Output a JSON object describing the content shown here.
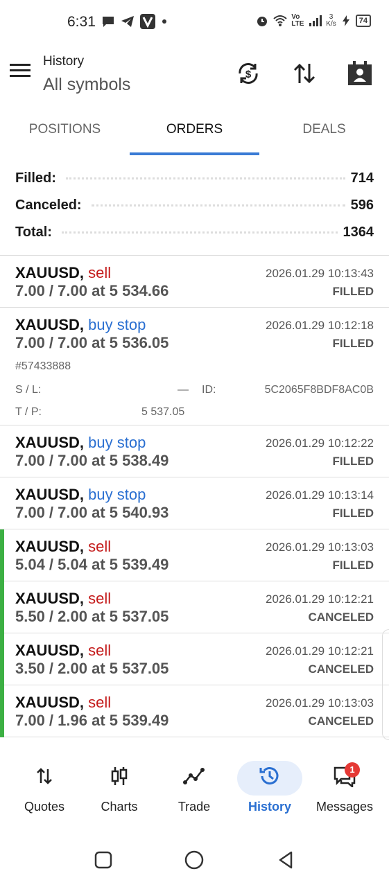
{
  "status_bar": {
    "time": "6:31",
    "network_label": "Vo LTE",
    "speed_value": "3",
    "speed_unit": "K/s",
    "battery": "74"
  },
  "header": {
    "title": "History",
    "subtitle": "All symbols"
  },
  "tabs": [
    {
      "label": "POSITIONS",
      "active": false
    },
    {
      "label": "ORDERS",
      "active": true
    },
    {
      "label": "DEALS",
      "active": false
    }
  ],
  "summary": [
    {
      "label": "Filled:",
      "value": "714"
    },
    {
      "label": "Canceled:",
      "value": "596"
    },
    {
      "label": "Total:",
      "value": "1364"
    }
  ],
  "orders": [
    {
      "symbol": "XAUUSD,",
      "type": "sell",
      "volume": "7.00 / 7.00 at 5 534.66",
      "time": "2026.01.29 10:13:43",
      "status": "FILLED",
      "marked": false
    },
    {
      "symbol": "XAUUSD,",
      "type": "buy stop",
      "volume": "7.00 / 7.00 at 5 536.05",
      "time": "2026.01.29 10:12:18",
      "status": "FILLED",
      "marked": false,
      "ticket": "#57433888",
      "sl_label": "S / L:",
      "sl_value": "—",
      "id_label": "ID:",
      "id_value": "5C2065F8BDF8AC0B",
      "tp_label": "T / P:",
      "tp_value": "5 537.05"
    },
    {
      "symbol": "XAUUSD,",
      "type": "buy stop",
      "volume": "7.00 / 7.00 at 5 538.49",
      "time": "2026.01.29 10:12:22",
      "status": "FILLED",
      "marked": false
    },
    {
      "symbol": "XAUUSD,",
      "type": "buy stop",
      "volume": "7.00 / 7.00 at 5 540.93",
      "time": "2026.01.29 10:13:14",
      "status": "FILLED",
      "marked": false
    },
    {
      "symbol": "XAUUSD,",
      "type": "sell",
      "volume": "5.04 / 5.04 at 5 539.49",
      "time": "2026.01.29 10:13:03",
      "status": "FILLED",
      "marked": true
    },
    {
      "symbol": "XAUUSD,",
      "type": "sell",
      "volume": "5.50 / 2.00 at 5 537.05",
      "time": "2026.01.29 10:12:21",
      "status": "CANCELED",
      "marked": true
    },
    {
      "symbol": "XAUUSD,",
      "type": "sell",
      "volume": "3.50 / 2.00 at 5 537.05",
      "time": "2026.01.29 10:12:21",
      "status": "CANCELED",
      "marked": true
    },
    {
      "symbol": "XAUUSD,",
      "type": "sell",
      "volume": "7.00 / 1.96 at 5 539.49",
      "time": "2026.01.29 10:13:03",
      "status": "CANCELED",
      "marked": true
    }
  ],
  "bottom_nav": [
    {
      "label": "Quotes",
      "icon": "quotes-arrows-icon",
      "active": false
    },
    {
      "label": "Charts",
      "icon": "candlestick-icon",
      "active": false
    },
    {
      "label": "Trade",
      "icon": "trade-line-icon",
      "active": false
    },
    {
      "label": "History",
      "icon": "history-clock-icon",
      "active": true
    },
    {
      "label": "Messages",
      "icon": "messages-icon",
      "active": false,
      "badge": "1"
    }
  ],
  "colors": {
    "accent": "#3a7bd5",
    "sell": "#c41a1a",
    "buy": "#2a6fd1",
    "marker": "#3cb043",
    "badge": "#e53935"
  }
}
